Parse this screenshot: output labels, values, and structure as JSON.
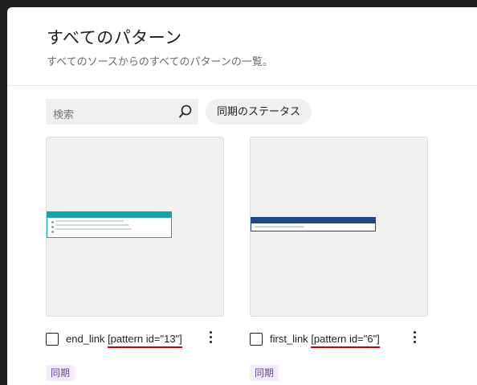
{
  "header": {
    "title": "すべてのパターン",
    "subtitle": "すべてのソースからのすべてのパターンの一覧。"
  },
  "search": {
    "placeholder": "検索",
    "icon": "search-icon"
  },
  "filter": {
    "sync_status_label": "同期のステータス"
  },
  "patterns": [
    {
      "name": "end_link",
      "id_label": "[pattern id=\"13\"]",
      "badge": "同期",
      "accent": "#17a2a8"
    },
    {
      "name": "first_link",
      "id_label": "[pattern id=\"6\"]",
      "badge": "同期",
      "accent": "#1f4a8a"
    }
  ]
}
